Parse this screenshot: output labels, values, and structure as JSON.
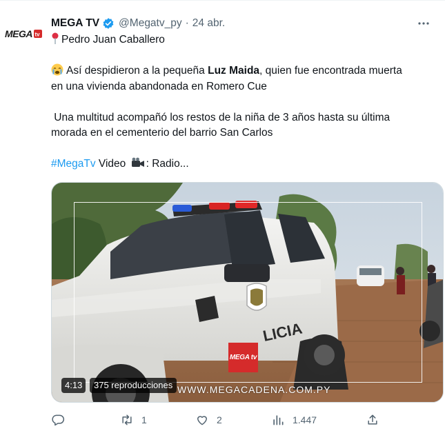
{
  "tweet": {
    "display_name": "MEGA TV",
    "handle": "@Megatv_py",
    "separator": "·",
    "date": "24 abr.",
    "avatar_logo": "MEGA tv",
    "more_icon": "more-horizontal-icon",
    "verified_icon": "verified-badge-icon",
    "line1_icon": "round-pushpin-icon",
    "line1": "Pedro Juan Caballero",
    "line2_icon": "crying-face-icon",
    "line2_prefix": "Así despidieron a la pequeña ",
    "line2_bold": "Luz Maida",
    "line2_suffix": ", quien fue encontrada muerta",
    "line3": "en una vivienda abandonada en Romero Cue",
    "line4": " Una multitud acompañó los restos de la niña de 3 años hasta su última",
    "line5": "morada en el cementerio del barrio San Carlos",
    "hashtag": "#MegaTv",
    "video_label": " Video ",
    "camera_icon": "movie-camera-icon",
    "video_suffix": ": Radio..."
  },
  "media": {
    "duration": "4:13",
    "views": "375 reproducciones",
    "watermark": "WWW.MEGACADENA.COM.PY",
    "logo_text": "MEGA tv",
    "car_text": "LICIA"
  },
  "actions": {
    "reply_icon": "reply-icon",
    "retweet_icon": "retweet-icon",
    "retweet_count": "1",
    "like_icon": "heart-icon",
    "like_count": "2",
    "views_icon": "analytics-icon",
    "views_count": "1.447",
    "share_icon": "share-icon"
  },
  "colors": {
    "accent": "#1d9bf0",
    "text": "#0f1419",
    "secondary": "#536471",
    "logo_red": "#d52b2b"
  }
}
